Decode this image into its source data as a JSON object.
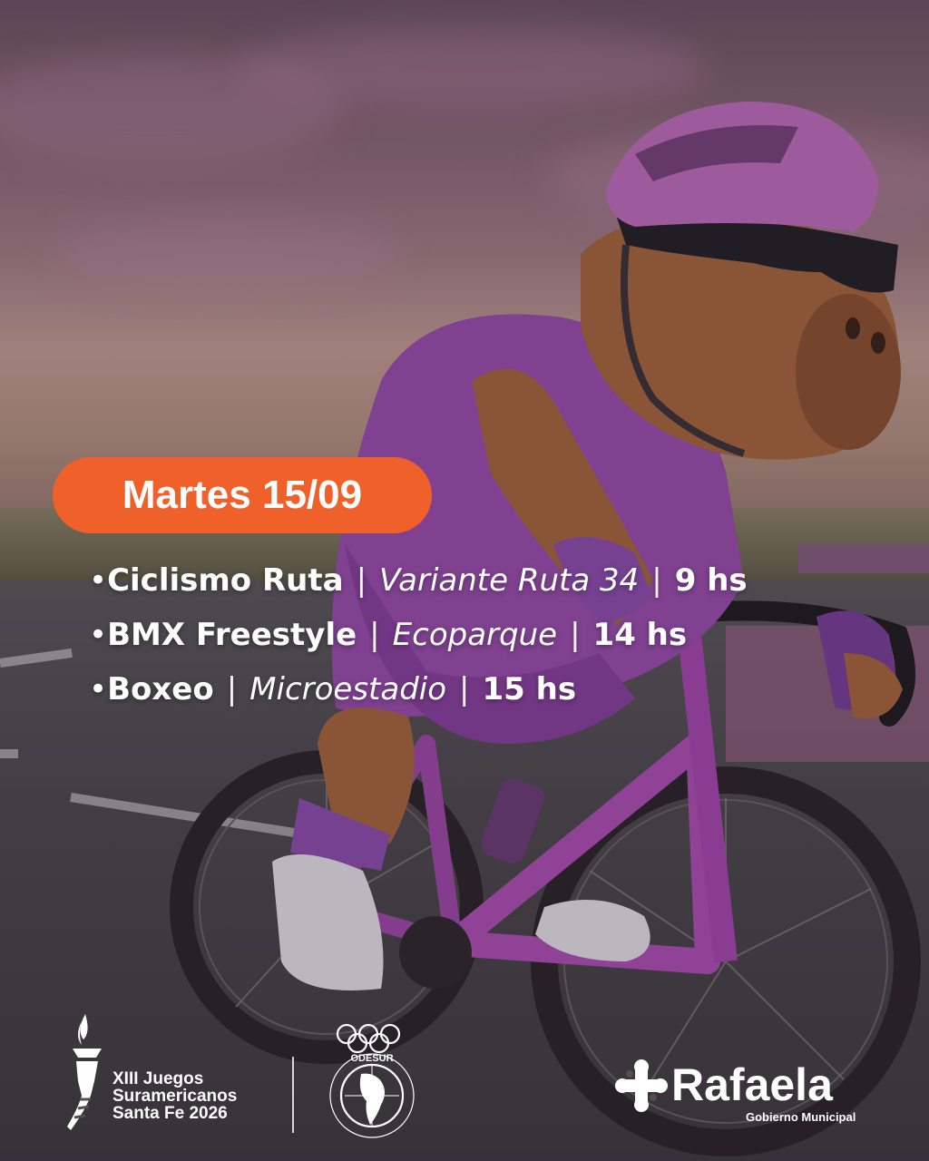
{
  "date_badge": "Martes 15/09",
  "events": [
    {
      "sport": "Ciclismo Ruta",
      "place": "Variante Ruta 34",
      "time": "9 hs"
    },
    {
      "sport": "BMX Freestyle",
      "place": "Ecoparque",
      "time": "14 hs"
    },
    {
      "sport": "Boxeo",
      "place": "Microestadio",
      "time": "15 hs"
    }
  ],
  "separator": "|",
  "bullet": "•",
  "footer": {
    "games_logo": {
      "line1": "XIII Juegos",
      "line2": "Suramericanos",
      "line3": "Santa Fe 2026",
      "icon": "torch-icon"
    },
    "odesur_logo": {
      "label": "ODESUR",
      "ring_text": "ORGANIZACIÓN DEPORTIVA SURAMERICANA",
      "icon": "olympic-rings-icon"
    },
    "municipality_logo": {
      "name": "Rafaela",
      "subtitle": "Gobierno Municipal",
      "icon": "rafaela-cross-icon"
    }
  },
  "colors": {
    "badge": "#f0602a",
    "text": "#ffffff",
    "jersey": "#9a4fb0",
    "helmet": "#c070c0"
  }
}
